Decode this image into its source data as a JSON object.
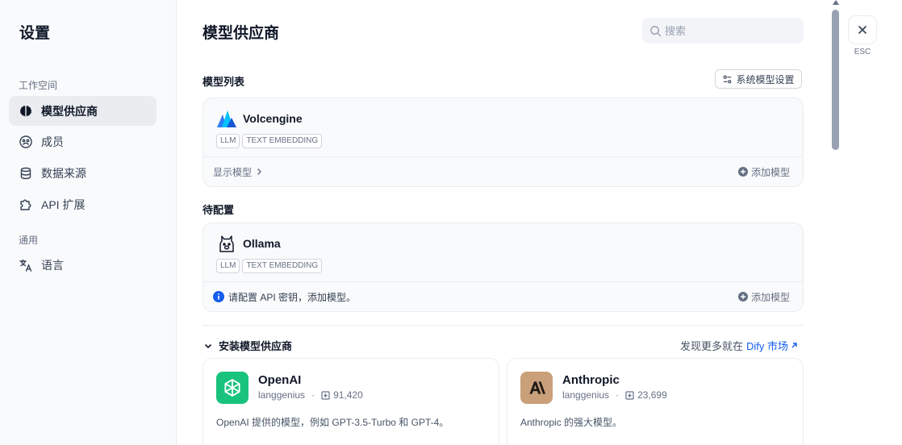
{
  "sidebar": {
    "title": "设置",
    "workspace_label": "工作空间",
    "general_label": "通用",
    "items": [
      {
        "label": "模型供应商",
        "icon": "brain-icon"
      },
      {
        "label": "成员",
        "icon": "members-icon"
      },
      {
        "label": "数据来源",
        "icon": "database-icon"
      },
      {
        "label": "API 扩展",
        "icon": "puzzle-icon"
      },
      {
        "label": "语言",
        "icon": "translate-icon"
      }
    ]
  },
  "header": {
    "title": "模型供应商",
    "search_placeholder": "搜索",
    "esc_label": "ESC"
  },
  "model_list": {
    "heading": "模型列表",
    "system_settings_label": "系统模型设置",
    "providers": [
      {
        "name": "Volcengine",
        "tags": [
          "LLM",
          "TEXT EMBEDDING"
        ],
        "show_models_label": "显示模型",
        "add_model_label": "添加模型"
      }
    ]
  },
  "pending": {
    "heading": "待配置",
    "providers": [
      {
        "name": "Ollama",
        "tags": [
          "LLM",
          "TEXT EMBEDDING"
        ],
        "warning": "请配置 API 密钥，添加模型。",
        "add_model_label": "添加模型"
      }
    ]
  },
  "install": {
    "heading": "安装模型供应商",
    "more_prefix": "发现更多就在",
    "market_link": "Dify 市场",
    "plugins": [
      {
        "name": "OpenAI",
        "author": "langgenius",
        "installs": "91,420",
        "description": "OpenAI 提供的模型，例如 GPT-3.5-Turbo 和 GPT-4。",
        "logo_color": "#19c37d"
      },
      {
        "name": "Anthropic",
        "author": "langgenius",
        "installs": "23,699",
        "description": "Anthropic 的强大模型。",
        "logo_color": "#caa07a"
      }
    ]
  },
  "colors": {
    "accent": "#155eef",
    "sidebar_bg": "#f9fafb",
    "active_item_bg": "#eaecf0",
    "info_blue": "#155eef"
  }
}
